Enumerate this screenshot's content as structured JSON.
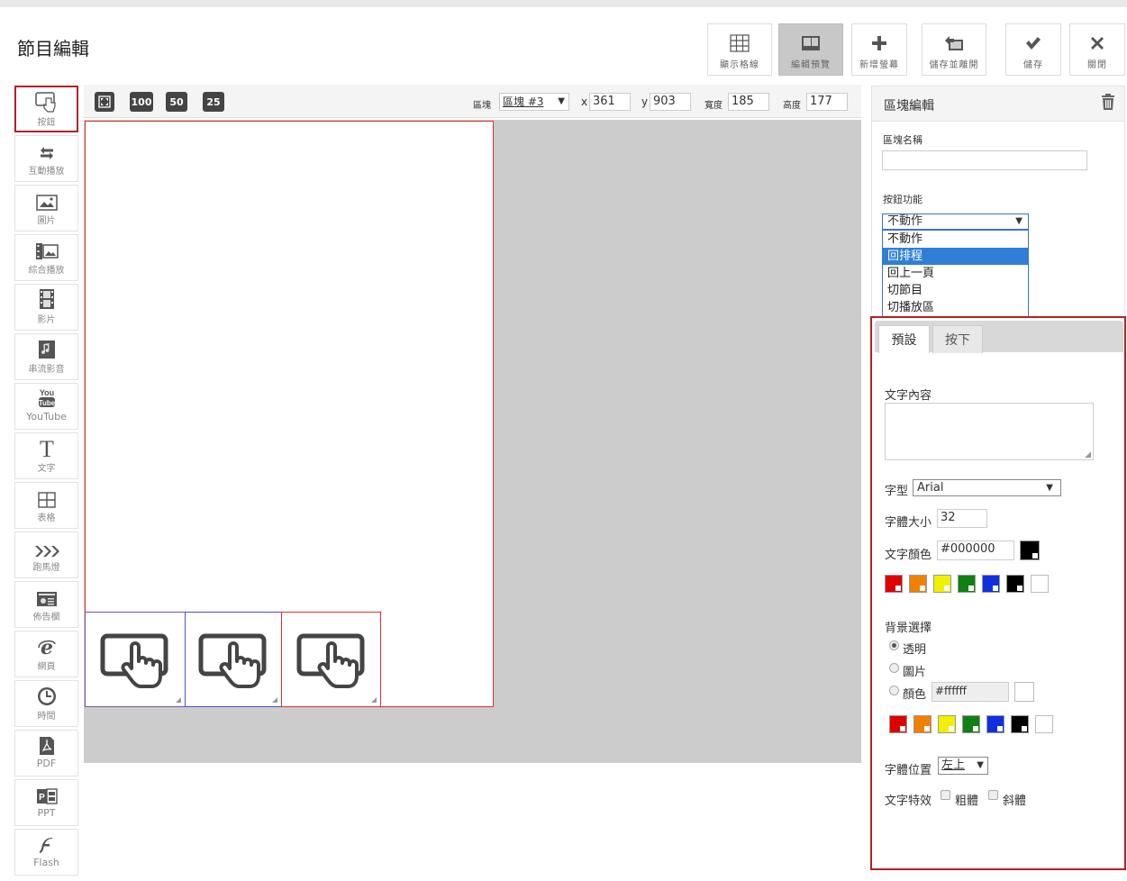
{
  "page": {
    "title": "節目編輯"
  },
  "toolbar": {
    "show_grid": {
      "label": "顯示格線",
      "icon": "grid-icon"
    },
    "edit_preview": {
      "label": "編輯預覽",
      "icon": "preview-icon"
    },
    "new_screen": {
      "label": "新增螢幕",
      "icon": "plus-icon"
    },
    "save_and_leave": {
      "label": "儲存並離開",
      "icon": "save-exit-icon"
    },
    "save": {
      "label": "儲存",
      "icon": "check-icon"
    },
    "close": {
      "label": "關閉",
      "icon": "close-icon"
    }
  },
  "sidebar": {
    "items": [
      {
        "label": "按鈕",
        "icon": "button-touch-icon"
      },
      {
        "label": "互動播放",
        "icon": "arrows-icon"
      },
      {
        "label": "圖片",
        "icon": "image-icon"
      },
      {
        "label": "綜合播放",
        "icon": "mixed-media-icon"
      },
      {
        "label": "影片",
        "icon": "film-icon"
      },
      {
        "label": "串流影音",
        "icon": "streaming-icon"
      },
      {
        "label": "YouTube",
        "icon": "youtube-icon"
      },
      {
        "label": "文字",
        "icon": "text-icon"
      },
      {
        "label": "表格",
        "icon": "table-icon"
      },
      {
        "label": "跑馬燈",
        "icon": "marquee-icon"
      },
      {
        "label": "佈告欄",
        "icon": "bulletin-icon"
      },
      {
        "label": "網頁",
        "icon": "ie-icon"
      },
      {
        "label": "時間",
        "icon": "clock-icon"
      },
      {
        "label": "PDF",
        "icon": "pdf-icon"
      },
      {
        "label": "PPT",
        "icon": "ppt-icon"
      },
      {
        "label": "Flash",
        "icon": "flash-icon"
      }
    ]
  },
  "canvas_bar": {
    "zoom_fit_icon": "zoom-fit-icon",
    "zoom_100": "100",
    "zoom_50": "50",
    "zoom_25": "25",
    "block_label": "區塊",
    "block_select": "區塊 #3",
    "x_label": "x",
    "x_value": "361",
    "y_label": "y",
    "y_value": "903",
    "width_label": "寬度",
    "width_value": "185",
    "height_label": "高度",
    "height_value": "177"
  },
  "canvas": {
    "blocks": [
      {
        "icon": "button-touch-icon",
        "border": "#7b4fa0"
      },
      {
        "icon": "button-touch-icon",
        "border": "#4a4fd0"
      },
      {
        "icon": "button-touch-icon",
        "border": "#e03030"
      }
    ]
  },
  "block_edit": {
    "title": "區塊編輯",
    "trash_icon": "trash-icon",
    "name_label": "區塊名稱",
    "name_value": "",
    "function_label": "按鈕功能",
    "function_selected": "不動作",
    "function_options": [
      "不動作",
      "回排程",
      "回上一頁",
      "切節目",
      "切播放區"
    ],
    "function_highlighted": "回排程"
  },
  "format": {
    "tabs": [
      "預設",
      "按下"
    ],
    "text_content_label": "文字內容",
    "text_content_value": "",
    "font_label": "字型",
    "font_value": "Arial",
    "font_size_label": "字體大小",
    "font_size_value": "32",
    "text_color_label": "文字顏色",
    "text_color_value": "#000000",
    "swatches": [
      "#e00000",
      "#f08000",
      "#f0f000",
      "#108010",
      "#1030e0",
      "#000000",
      "#ffffff"
    ],
    "bg_label": "背景選擇",
    "bg_options": [
      "透明",
      "圖片",
      "顏色"
    ],
    "bg_selected": "透明",
    "bg_color_value": "#ffffff",
    "position_label": "字體位置",
    "position_value": "左上",
    "effect_label": "文字特效",
    "bold_label": "粗體",
    "italic_label": "斜體"
  }
}
